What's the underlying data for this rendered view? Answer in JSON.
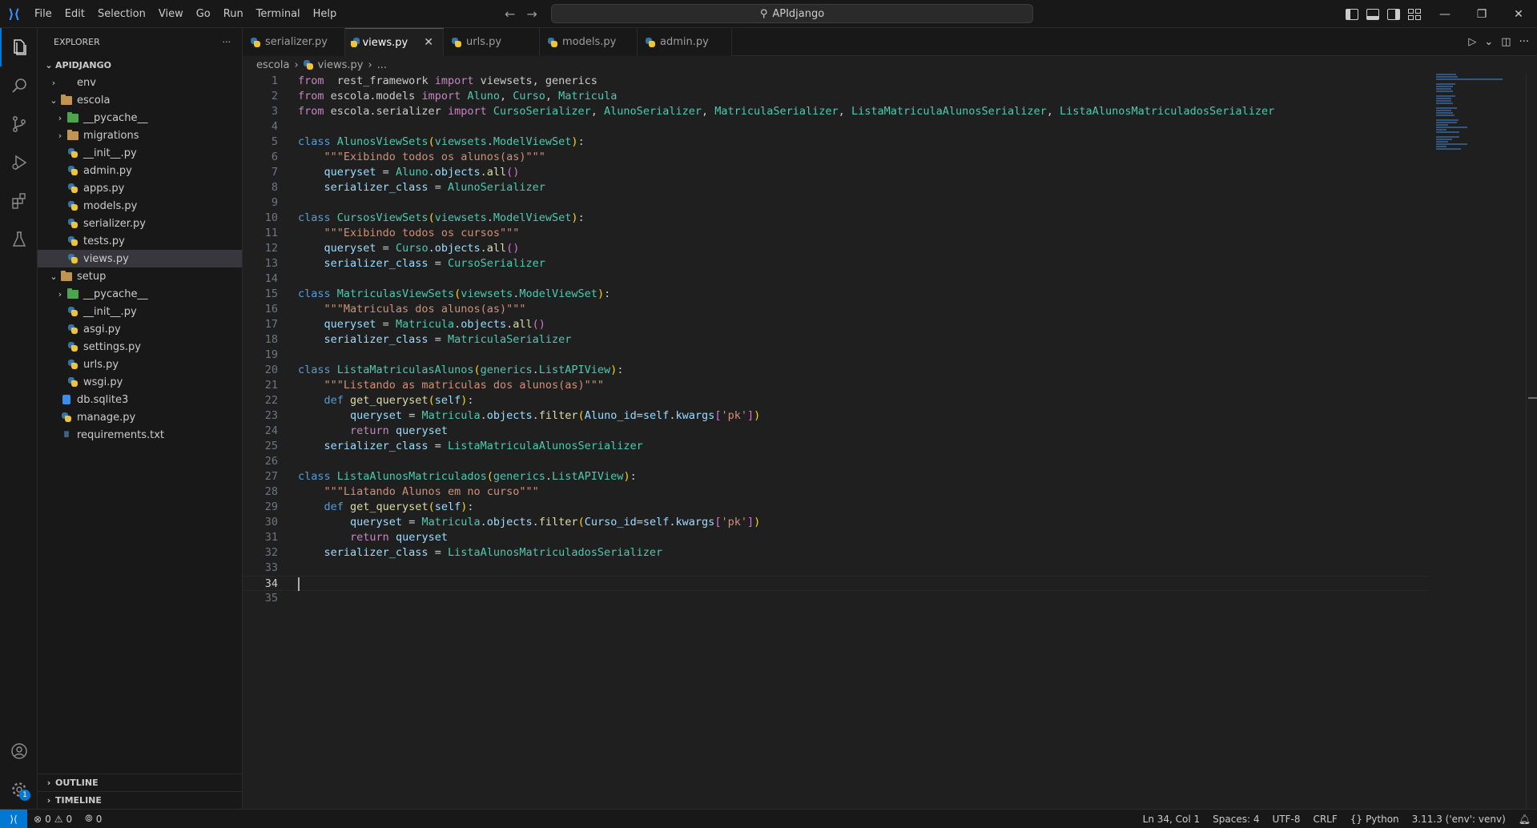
{
  "titlebar": {
    "menu": [
      "File",
      "Edit",
      "Selection",
      "View",
      "Go",
      "Run",
      "Terminal",
      "Help"
    ],
    "search_text": "APIdjango"
  },
  "sidebar": {
    "header": "EXPLORER",
    "workspace": "APIDJANGO",
    "tree": [
      {
        "label": "env",
        "depth": 1,
        "type": "folder-closed"
      },
      {
        "label": "escola",
        "depth": 1,
        "type": "folder-open"
      },
      {
        "label": "__pycache__",
        "depth": 2,
        "type": "pyfolder-closed"
      },
      {
        "label": "migrations",
        "depth": 2,
        "type": "folder-closed"
      },
      {
        "label": "__init__.py",
        "depth": 2,
        "type": "py"
      },
      {
        "label": "admin.py",
        "depth": 2,
        "type": "py"
      },
      {
        "label": "apps.py",
        "depth": 2,
        "type": "py"
      },
      {
        "label": "models.py",
        "depth": 2,
        "type": "py"
      },
      {
        "label": "serializer.py",
        "depth": 2,
        "type": "py"
      },
      {
        "label": "tests.py",
        "depth": 2,
        "type": "py"
      },
      {
        "label": "views.py",
        "depth": 2,
        "type": "py",
        "selected": true
      },
      {
        "label": "setup",
        "depth": 1,
        "type": "folder-open"
      },
      {
        "label": "__pycache__",
        "depth": 2,
        "type": "pyfolder-closed"
      },
      {
        "label": "__init__.py",
        "depth": 2,
        "type": "py"
      },
      {
        "label": "asgi.py",
        "depth": 2,
        "type": "py"
      },
      {
        "label": "settings.py",
        "depth": 2,
        "type": "py"
      },
      {
        "label": "urls.py",
        "depth": 2,
        "type": "py"
      },
      {
        "label": "wsgi.py",
        "depth": 2,
        "type": "py"
      },
      {
        "label": "db.sqlite3",
        "depth": 1,
        "type": "db"
      },
      {
        "label": "manage.py",
        "depth": 1,
        "type": "py"
      },
      {
        "label": "requirements.txt",
        "depth": 1,
        "type": "txt"
      }
    ],
    "outline": "OUTLINE",
    "timeline": "TIMELINE"
  },
  "tabs": [
    {
      "label": "serializer.py",
      "active": false
    },
    {
      "label": "views.py",
      "active": true
    },
    {
      "label": "urls.py",
      "active": false
    },
    {
      "label": "models.py",
      "active": false
    },
    {
      "label": "admin.py",
      "active": false
    }
  ],
  "breadcrumb": {
    "folder": "escola",
    "file": "views.py",
    "more": "..."
  },
  "editor": {
    "current_line": 34,
    "lines": [
      [
        [
          "kw2",
          "from"
        ],
        [
          "",
          "  "
        ],
        [
          "",
          "rest_framework "
        ],
        [
          "kw2",
          "import"
        ],
        [
          "",
          " viewsets, generics"
        ]
      ],
      [
        [
          "kw2",
          "from"
        ],
        [
          "",
          " escola.models "
        ],
        [
          "kw2",
          "import"
        ],
        [
          "cls",
          " Aluno"
        ],
        [
          "",
          ", "
        ],
        [
          "cls",
          "Curso"
        ],
        [
          "",
          ", "
        ],
        [
          "cls",
          "Matricula"
        ]
      ],
      [
        [
          "kw2",
          "from"
        ],
        [
          "",
          " escola.serializer "
        ],
        [
          "kw2",
          "import"
        ],
        [
          "cls",
          " CursoSerializer"
        ],
        [
          "",
          ", "
        ],
        [
          "cls",
          "AlunoSerializer"
        ],
        [
          "",
          ", "
        ],
        [
          "cls",
          "MatriculaSerializer"
        ],
        [
          "",
          ", "
        ],
        [
          "cls",
          "ListaMatriculaAlunosSerializer"
        ],
        [
          "",
          ", "
        ],
        [
          "cls",
          "ListaAlunosMatriculadosSerializer"
        ]
      ],
      [],
      [
        [
          "kw",
          "class"
        ],
        [
          "cls",
          " AlunosViewSets"
        ],
        [
          "p1",
          "("
        ],
        [
          "cls",
          "viewsets"
        ],
        [
          "",
          "."
        ],
        [
          "cls",
          "ModelViewSet"
        ],
        [
          "p1",
          ")"
        ],
        [
          "",
          ":"
        ]
      ],
      [
        [
          "",
          "    "
        ],
        [
          "str",
          "\"\"\"Exibindo todos os alunos(as)\"\"\""
        ]
      ],
      [
        [
          "",
          "    "
        ],
        [
          "var",
          "queryset"
        ],
        [
          "",
          " = "
        ],
        [
          "cls",
          "Aluno"
        ],
        [
          "",
          "."
        ],
        [
          "var",
          "objects"
        ],
        [
          "",
          "."
        ],
        [
          "fn",
          "all"
        ],
        [
          "p2",
          "()"
        ]
      ],
      [
        [
          "",
          "    "
        ],
        [
          "var",
          "serializer_class"
        ],
        [
          "",
          " = "
        ],
        [
          "cls",
          "AlunoSerializer"
        ]
      ],
      [],
      [
        [
          "kw",
          "class"
        ],
        [
          "cls",
          " CursosViewSets"
        ],
        [
          "p1",
          "("
        ],
        [
          "cls",
          "viewsets"
        ],
        [
          "",
          "."
        ],
        [
          "cls",
          "ModelViewSet"
        ],
        [
          "p1",
          ")"
        ],
        [
          "",
          ":"
        ]
      ],
      [
        [
          "",
          "    "
        ],
        [
          "str",
          "\"\"\"Exibindo todos os cursos\"\"\""
        ]
      ],
      [
        [
          "",
          "    "
        ],
        [
          "var",
          "queryset"
        ],
        [
          "",
          " = "
        ],
        [
          "cls",
          "Curso"
        ],
        [
          "",
          "."
        ],
        [
          "var",
          "objects"
        ],
        [
          "",
          "."
        ],
        [
          "fn",
          "all"
        ],
        [
          "p2",
          "()"
        ]
      ],
      [
        [
          "",
          "    "
        ],
        [
          "var",
          "serializer_class"
        ],
        [
          "",
          " = "
        ],
        [
          "cls",
          "CursoSerializer"
        ]
      ],
      [],
      [
        [
          "kw",
          "class"
        ],
        [
          "cls",
          " MatriculasViewSets"
        ],
        [
          "p1",
          "("
        ],
        [
          "cls",
          "viewsets"
        ],
        [
          "",
          "."
        ],
        [
          "cls",
          "ModelViewSet"
        ],
        [
          "p1",
          ")"
        ],
        [
          "",
          ":"
        ]
      ],
      [
        [
          "",
          "    "
        ],
        [
          "str",
          "\"\"\"Matriculas dos alunos(as)\"\"\""
        ]
      ],
      [
        [
          "",
          "    "
        ],
        [
          "var",
          "queryset"
        ],
        [
          "",
          " = "
        ],
        [
          "cls",
          "Matricula"
        ],
        [
          "",
          "."
        ],
        [
          "var",
          "objects"
        ],
        [
          "",
          "."
        ],
        [
          "fn",
          "all"
        ],
        [
          "p2",
          "()"
        ]
      ],
      [
        [
          "",
          "    "
        ],
        [
          "var",
          "serializer_class"
        ],
        [
          "",
          " = "
        ],
        [
          "cls",
          "MatriculaSerializer"
        ]
      ],
      [],
      [
        [
          "kw",
          "class"
        ],
        [
          "cls",
          " ListaMatriculasAlunos"
        ],
        [
          "p1",
          "("
        ],
        [
          "cls",
          "generics"
        ],
        [
          "",
          "."
        ],
        [
          "cls",
          "ListAPIView"
        ],
        [
          "p1",
          ")"
        ],
        [
          "",
          ":"
        ]
      ],
      [
        [
          "",
          "    "
        ],
        [
          "str",
          "\"\"\"Listando as matriculas dos alunos(as)\"\"\""
        ]
      ],
      [
        [
          "",
          "    "
        ],
        [
          "kw",
          "def"
        ],
        [
          "fn",
          " get_queryset"
        ],
        [
          "p1",
          "("
        ],
        [
          "var",
          "self"
        ],
        [
          "p1",
          ")"
        ],
        [
          "",
          ":"
        ]
      ],
      [
        [
          "",
          "        "
        ],
        [
          "var",
          "queryset"
        ],
        [
          "",
          " = "
        ],
        [
          "cls",
          "Matricula"
        ],
        [
          "",
          "."
        ],
        [
          "var",
          "objects"
        ],
        [
          "",
          "."
        ],
        [
          "fn",
          "filter"
        ],
        [
          "p1",
          "("
        ],
        [
          "var",
          "Aluno_id"
        ],
        [
          "",
          "="
        ],
        [
          "var",
          "self"
        ],
        [
          "",
          "."
        ],
        [
          "var",
          "kwargs"
        ],
        [
          "p2",
          "["
        ],
        [
          "str",
          "'pk'"
        ],
        [
          "p2",
          "]"
        ],
        [
          "p1",
          ")"
        ]
      ],
      [
        [
          "",
          "        "
        ],
        [
          "kw2",
          "return"
        ],
        [
          "var",
          " queryset"
        ]
      ],
      [
        [
          "",
          "    "
        ],
        [
          "var",
          "serializer_class"
        ],
        [
          "",
          " = "
        ],
        [
          "cls",
          "ListaMatriculaAlunosSerializer"
        ]
      ],
      [],
      [
        [
          "kw",
          "class"
        ],
        [
          "cls",
          " ListaAlunosMatriculados"
        ],
        [
          "p1",
          "("
        ],
        [
          "cls",
          "generics"
        ],
        [
          "",
          "."
        ],
        [
          "cls",
          "ListAPIView"
        ],
        [
          "p1",
          ")"
        ],
        [
          "",
          ":"
        ]
      ],
      [
        [
          "",
          "    "
        ],
        [
          "str",
          "\"\"\"Liatando Alunos em no curso\"\"\""
        ]
      ],
      [
        [
          "",
          "    "
        ],
        [
          "kw",
          "def"
        ],
        [
          "fn",
          " get_queryset"
        ],
        [
          "p1",
          "("
        ],
        [
          "var",
          "self"
        ],
        [
          "p1",
          ")"
        ],
        [
          "",
          ":"
        ]
      ],
      [
        [
          "",
          "        "
        ],
        [
          "var",
          "queryset"
        ],
        [
          "",
          " = "
        ],
        [
          "cls",
          "Matricula"
        ],
        [
          "",
          "."
        ],
        [
          "var",
          "objects"
        ],
        [
          "",
          "."
        ],
        [
          "fn",
          "filter"
        ],
        [
          "p1",
          "("
        ],
        [
          "var",
          "Curso_id"
        ],
        [
          "",
          "="
        ],
        [
          "var",
          "self"
        ],
        [
          "",
          "."
        ],
        [
          "var",
          "kwargs"
        ],
        [
          "p2",
          "["
        ],
        [
          "str",
          "'pk'"
        ],
        [
          "p2",
          "]"
        ],
        [
          "p1",
          ")"
        ]
      ],
      [
        [
          "",
          "        "
        ],
        [
          "kw2",
          "return"
        ],
        [
          "var",
          " queryset"
        ]
      ],
      [
        [
          "",
          "    "
        ],
        [
          "var",
          "serializer_class"
        ],
        [
          "",
          " = "
        ],
        [
          "cls",
          "ListaAlunosMatriculadosSerializer"
        ]
      ],
      [],
      [],
      []
    ]
  },
  "statusbar": {
    "errors": "0",
    "warnings": "0",
    "ports": "0",
    "position": "Ln 34, Col 1",
    "spaces": "Spaces: 4",
    "encoding": "UTF-8",
    "eol": "CRLF",
    "language": "Python",
    "interpreter": "3.11.3 ('env': venv)"
  },
  "activity_badge": "1"
}
